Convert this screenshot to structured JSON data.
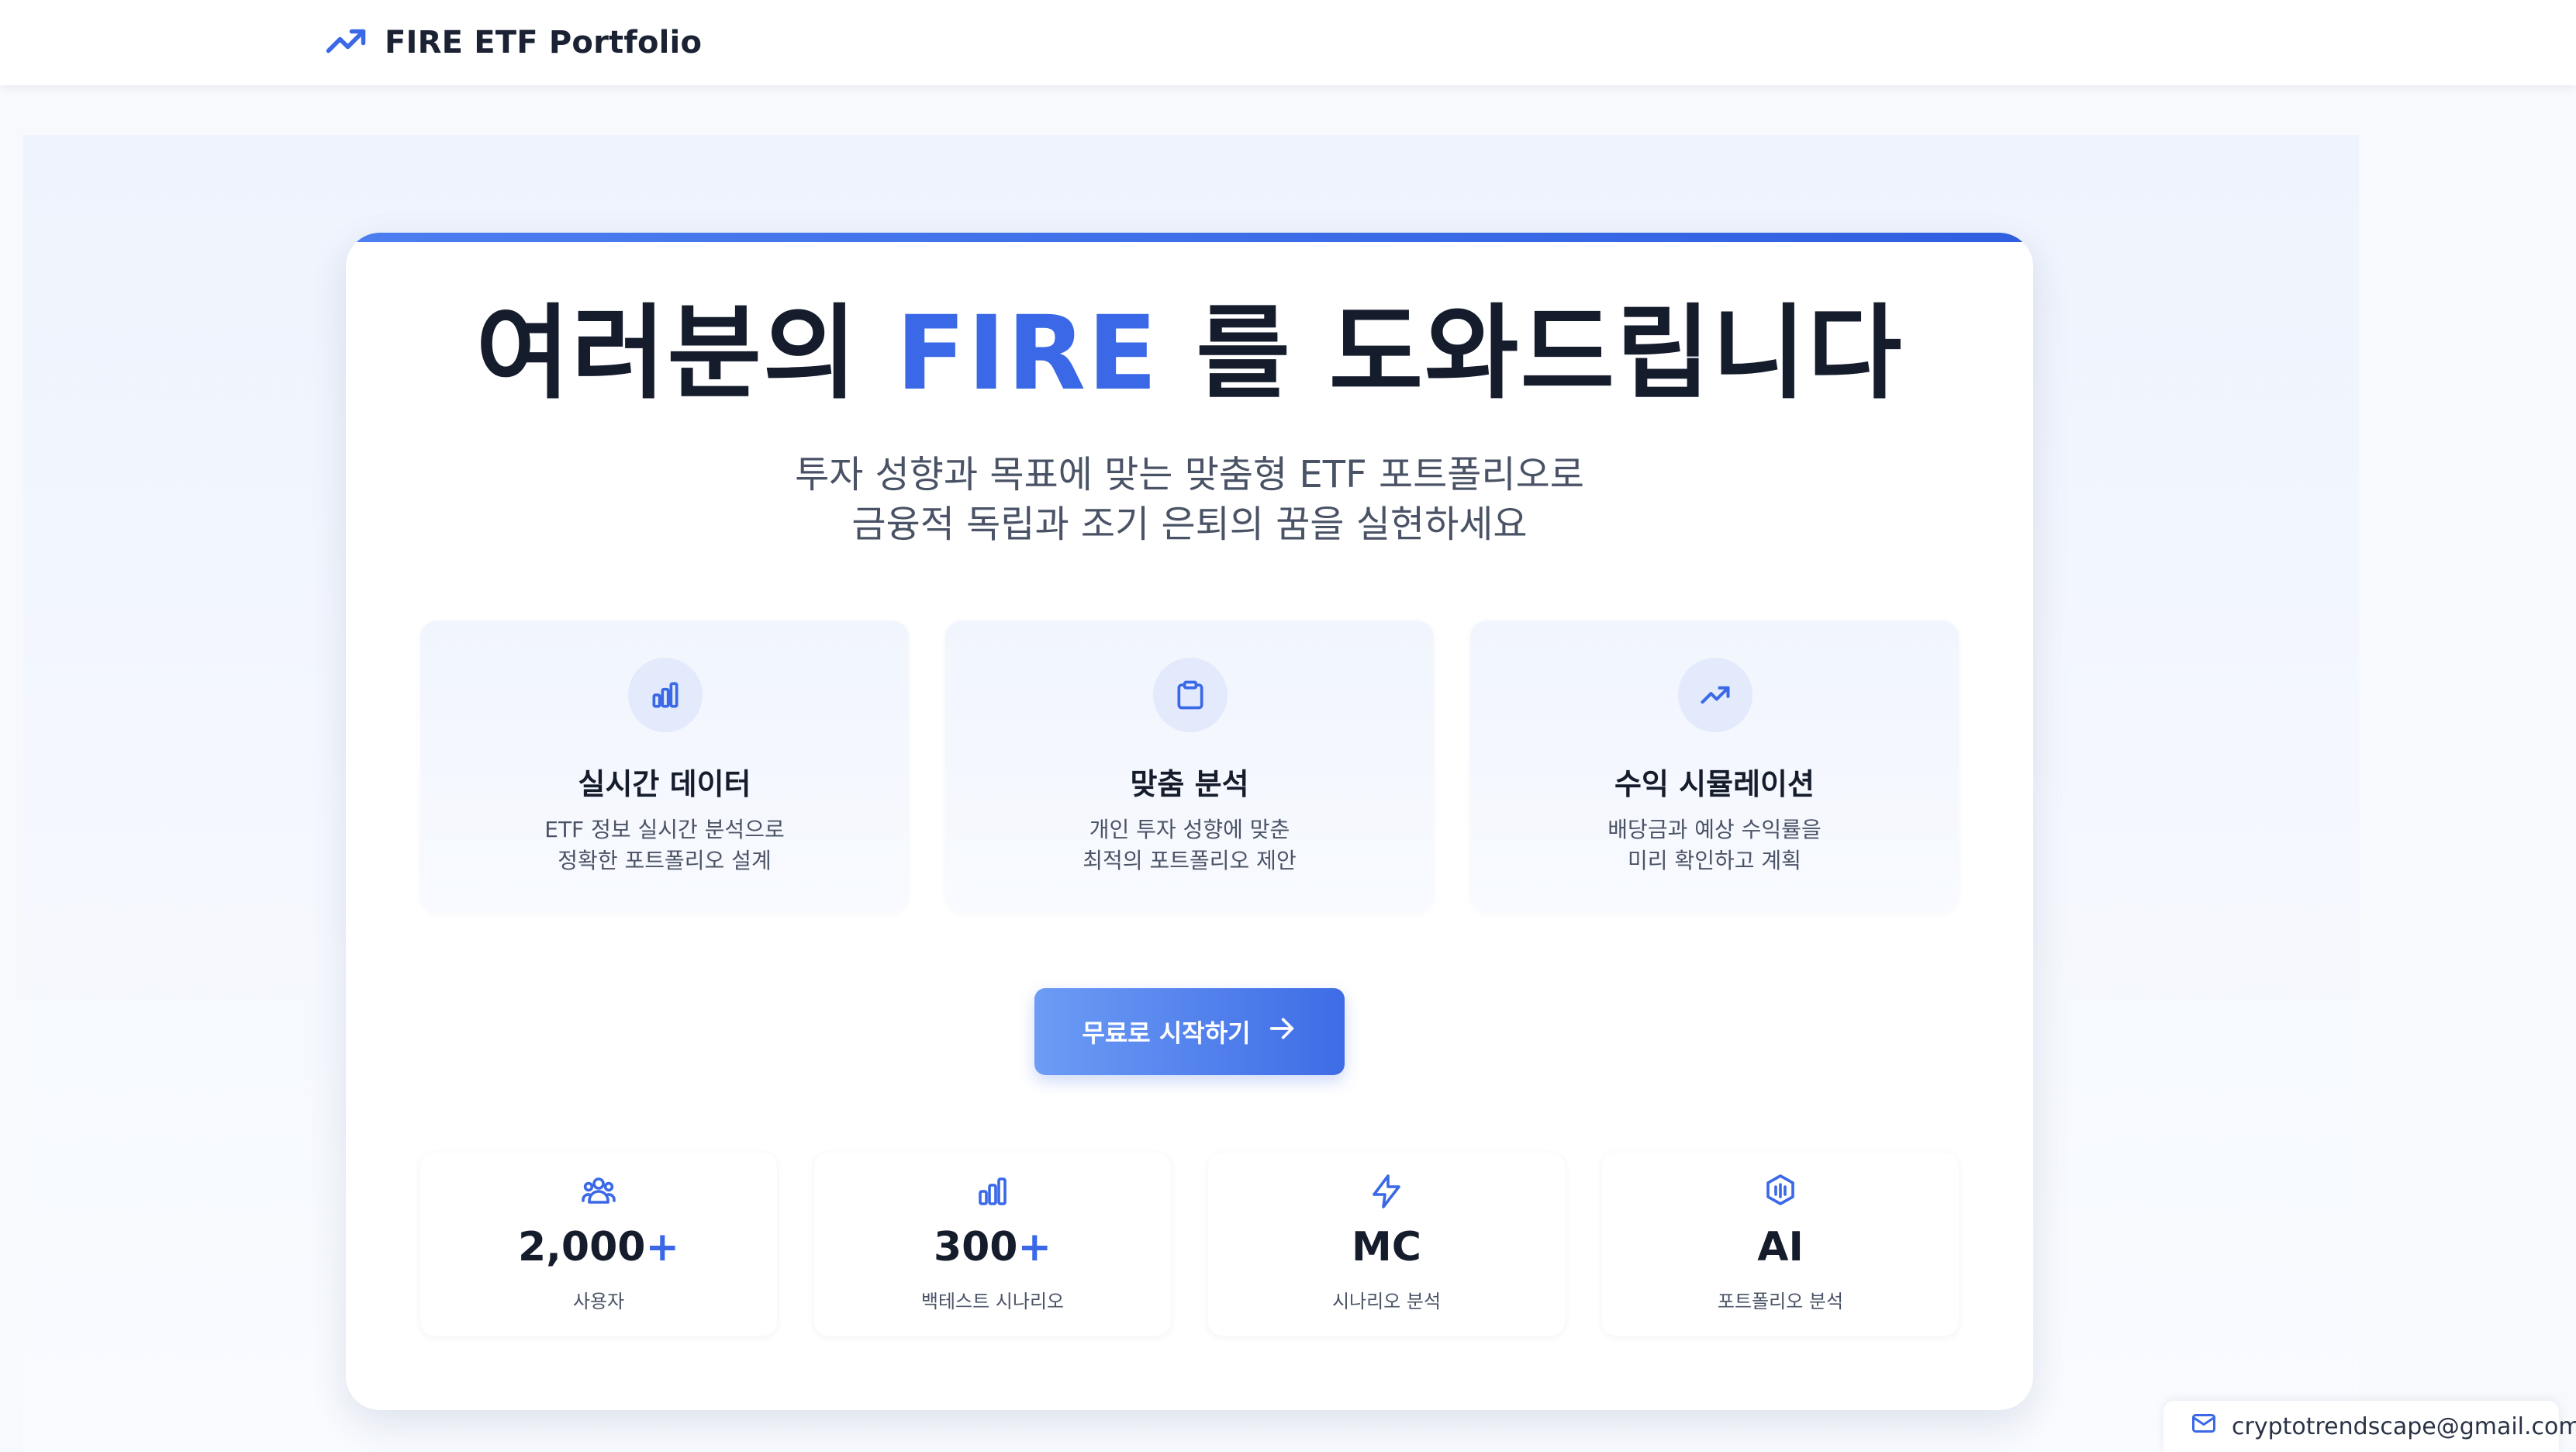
{
  "header": {
    "brand_icon": "trending-up-icon",
    "brand_title": "FIRE ETF Portfolio"
  },
  "hero": {
    "title_before": "여러분의 ",
    "title_accent": "FIRE",
    "title_after": " 를 도와드립니다",
    "subtitle_line1": "투자 성향과 목표에 맞는 맞춤형 ETF 포트폴리오로",
    "subtitle_line2": "금융적 독립과 조기 은퇴의 꿈을 실현하세요"
  },
  "features": [
    {
      "icon": "bar-chart-icon",
      "title": "실시간 데이터",
      "desc_line1": "ETF 정보 실시간 분석으로",
      "desc_line2": "정확한 포트폴리오 설계"
    },
    {
      "icon": "clipboard-icon",
      "title": "맞춤 분석",
      "desc_line1": "개인 투자 성향에 맞춘",
      "desc_line2": "최적의 포트폴리오 제안"
    },
    {
      "icon": "trending-up-icon",
      "title": "수익 시뮬레이션",
      "desc_line1": "배당금과 예상 수익률을",
      "desc_line2": "미리 확인하고 계획"
    }
  ],
  "cta": {
    "label": "무료로 시작하기",
    "icon": "arrow-right-icon"
  },
  "stats": [
    {
      "icon": "users-icon",
      "value": "2,000",
      "plus": "+",
      "label": "사용자"
    },
    {
      "icon": "bar-chart-icon",
      "value": "300",
      "plus": "+",
      "label": "백테스트 시나리오"
    },
    {
      "icon": "lightning-icon",
      "value": "MC",
      "plus": "",
      "label": "시나리오 분석"
    },
    {
      "icon": "ai-shield-icon",
      "value": "AI",
      "plus": "",
      "label": "포트폴리오 분석"
    }
  ],
  "footer": {
    "email_icon": "mail-icon",
    "email": "cryptotrendscape@gmail.com"
  },
  "colors": {
    "accent": "#3a68e6",
    "text_dark": "#151c2c",
    "text_muted": "#4a5366",
    "hero_bg": "#eef3fd"
  }
}
